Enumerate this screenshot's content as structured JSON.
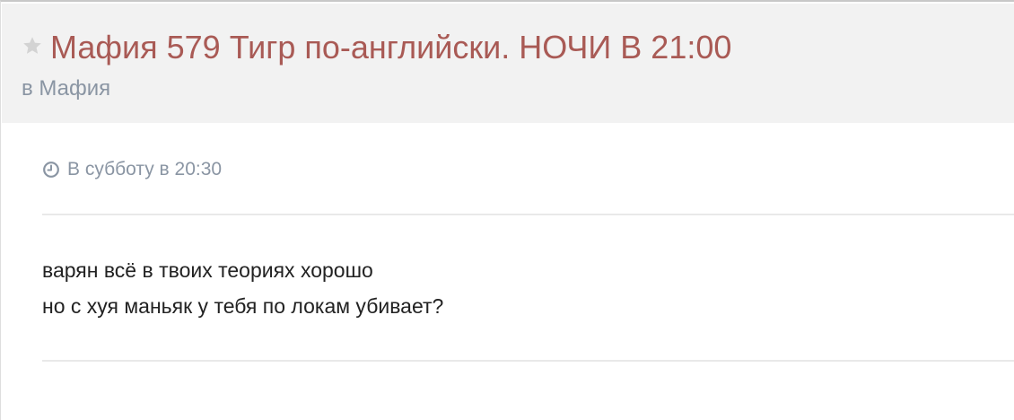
{
  "topic": {
    "title": "Мафия 579 Тигр по-английски. НОЧИ В 21:00",
    "forum_prefix": "в",
    "forum_name": "Мафия"
  },
  "post": {
    "timestamp": "В субботу в 20:30",
    "lines": [
      "варян всё в твоих теориях хорошо",
      "но с хуя маньяк у тебя по локам убивает?"
    ]
  },
  "colors": {
    "title": "#a95a55",
    "meta": "#8a95a3",
    "header_bg": "#f2f2f2",
    "text": "#222222"
  },
  "icons": {
    "follow": "star-icon",
    "time": "clock-icon"
  }
}
